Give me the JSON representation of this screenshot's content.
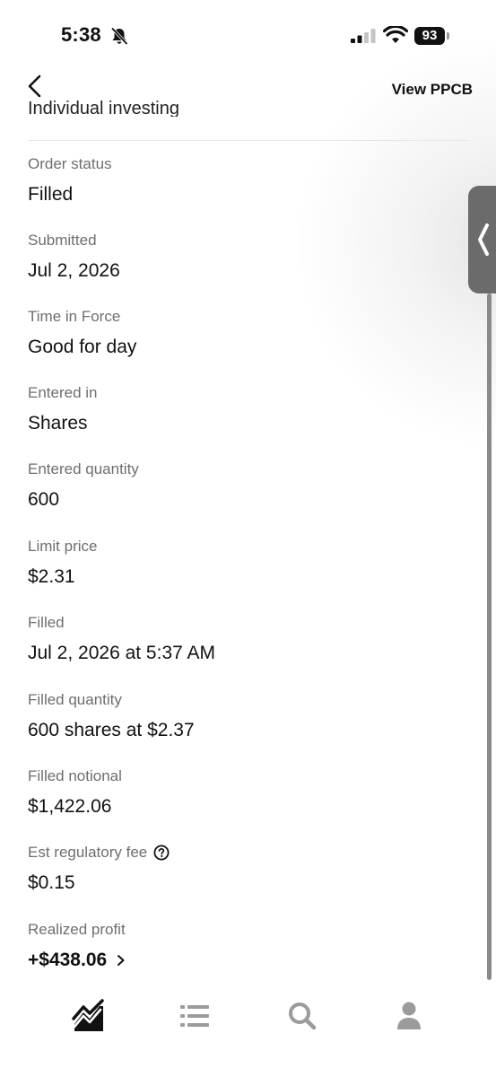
{
  "status_bar": {
    "time": "5:38",
    "battery": "93"
  },
  "header": {
    "view_link": "View PPCB",
    "cut_off_text": "Individual investing"
  },
  "fields": [
    {
      "label": "Order status",
      "value": "Filled"
    },
    {
      "label": "Submitted",
      "value": "Jul 2, 2026"
    },
    {
      "label": "Time in Force",
      "value": "Good for day"
    },
    {
      "label": "Entered in",
      "value": "Shares"
    },
    {
      "label": "Entered quantity",
      "value": "600"
    },
    {
      "label": "Limit price",
      "value": "$2.31"
    },
    {
      "label": "Filled",
      "value": "Jul 2, 2026 at 5:37 AM"
    },
    {
      "label": "Filled quantity",
      "value": "600 shares at $2.37"
    },
    {
      "label": "Filled notional",
      "value": "$1,422.06"
    },
    {
      "label": "Est regulatory fee",
      "value": "$0.15"
    },
    {
      "label": "Realized profit",
      "value": "+$438.06"
    }
  ],
  "icons": {
    "status": [
      "bell-slash-icon",
      "cellular-signal-icon",
      "wifi-icon",
      "battery-icon"
    ],
    "header": [
      "back-arrow-icon"
    ],
    "fee": "help-circle-icon",
    "profit": "chevron-right-icon",
    "side_tab": "chevron-left-icon",
    "bottom_nav": [
      "investing-chart-icon",
      "list-icon",
      "search-icon",
      "account-icon"
    ]
  },
  "colors": {
    "text": "#111111",
    "label": "#6e6e6e",
    "nav_active": "#111111",
    "nav_inactive": "#9b9b9b",
    "side_tab": "#6b6b6b"
  }
}
